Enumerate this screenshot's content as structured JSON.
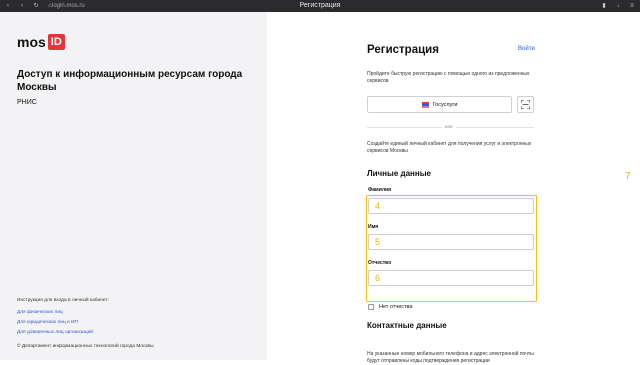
{
  "browser": {
    "url": "login.mos.ru",
    "tab_title": "Регистрация",
    "icons": [
      "shield-icon",
      "lock-icon",
      "bookmark-icon",
      "download-icon",
      "menu-icon"
    ]
  },
  "left": {
    "logo_text": "mos",
    "logo_badge": "ID",
    "title": "Доступ к информационным ресурсам города Москвы",
    "subtitle": "РНИС",
    "instruction": "Инструкция для входа в личный кабинет:",
    "links": [
      "Для физических лиц",
      "Для юридических лиц и ИП",
      "Для доверенных лиц организаций"
    ],
    "copyright": "© Департамент информационных технологий города Москвы"
  },
  "form": {
    "title": "Регистрация",
    "login_link": "Войти",
    "intro": "Пройдите быструю регистрацию с помощью одного из предложенных сервисов",
    "gosuslugi_label": "Госуслуги",
    "or_label": "или",
    "intro2": "Создайте единый личный кабинет для получения услуг и электронных сервисов Москвы",
    "personal_section": "Личные данные",
    "fields": [
      {
        "label": "Фамилия",
        "value": "4"
      },
      {
        "label": "Имя",
        "value": "5"
      },
      {
        "label": "Отчество",
        "value": "6"
      }
    ],
    "no_patronymic_label": "Нет отчества",
    "contact_section": "Контактные данные",
    "contact_desc": "На указанные номер мобильного телефона и адрес электронной почты будут отправлены коды подтверждения регистрации",
    "side_marker": "7"
  },
  "colors": {
    "brand_red": "#e8323c",
    "link_blue": "#2b5bd6",
    "highlight_yellow": "#f1c40f"
  }
}
